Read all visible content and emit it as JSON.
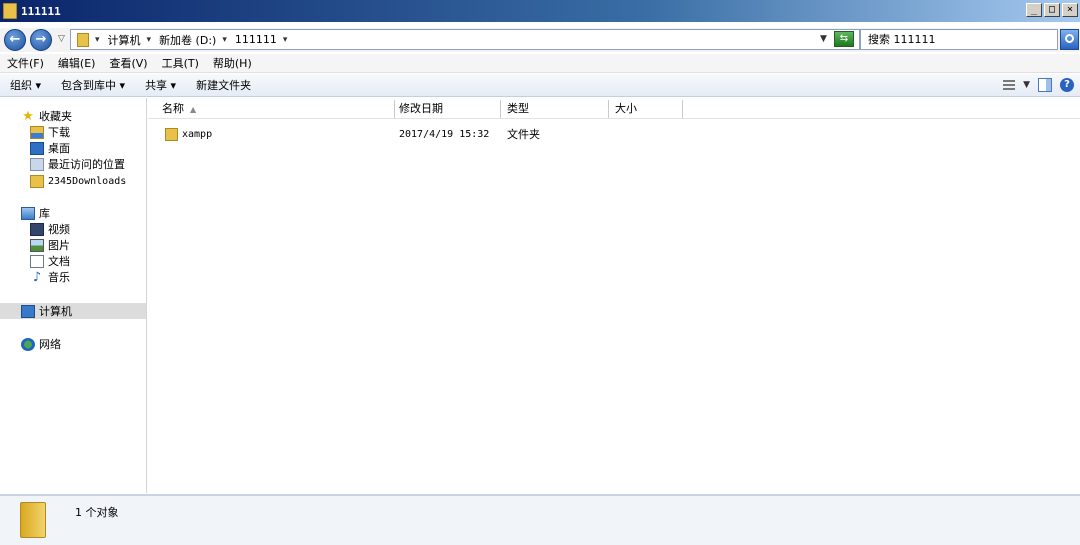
{
  "window": {
    "title": "111111",
    "minimize": "_",
    "maximize": "□",
    "close": "×"
  },
  "address": {
    "path": [
      "计算机",
      "新加卷 (D:)",
      "111111"
    ],
    "search_placeholder": "搜索 111111"
  },
  "menu": [
    "文件(F)",
    "编辑(E)",
    "查看(V)",
    "工具(T)",
    "帮助(H)"
  ],
  "toolbar": [
    "组织 ▾",
    "包含到库中 ▾",
    "共享 ▾",
    "新建文件夹"
  ],
  "navigation": {
    "favorites": {
      "label": "收藏夹",
      "items": [
        "下载",
        "桌面",
        "最近访问的位置",
        "2345Downloads"
      ]
    },
    "libraries": {
      "label": "库",
      "items": [
        "视频",
        "图片",
        "文档",
        "音乐"
      ]
    },
    "computer": "计算机",
    "network": "网络"
  },
  "columns": [
    "名称",
    "修改日期",
    "类型",
    "大小"
  ],
  "files": [
    {
      "name": "xampp",
      "modified": "2017/4/19 15:32",
      "type": "文件夹",
      "size": ""
    }
  ],
  "status": {
    "count_text": "1 个对象"
  },
  "colors": {
    "title_bar": "#0a246a",
    "selection": "#dcdcdc",
    "folder": "#e8c14a"
  }
}
